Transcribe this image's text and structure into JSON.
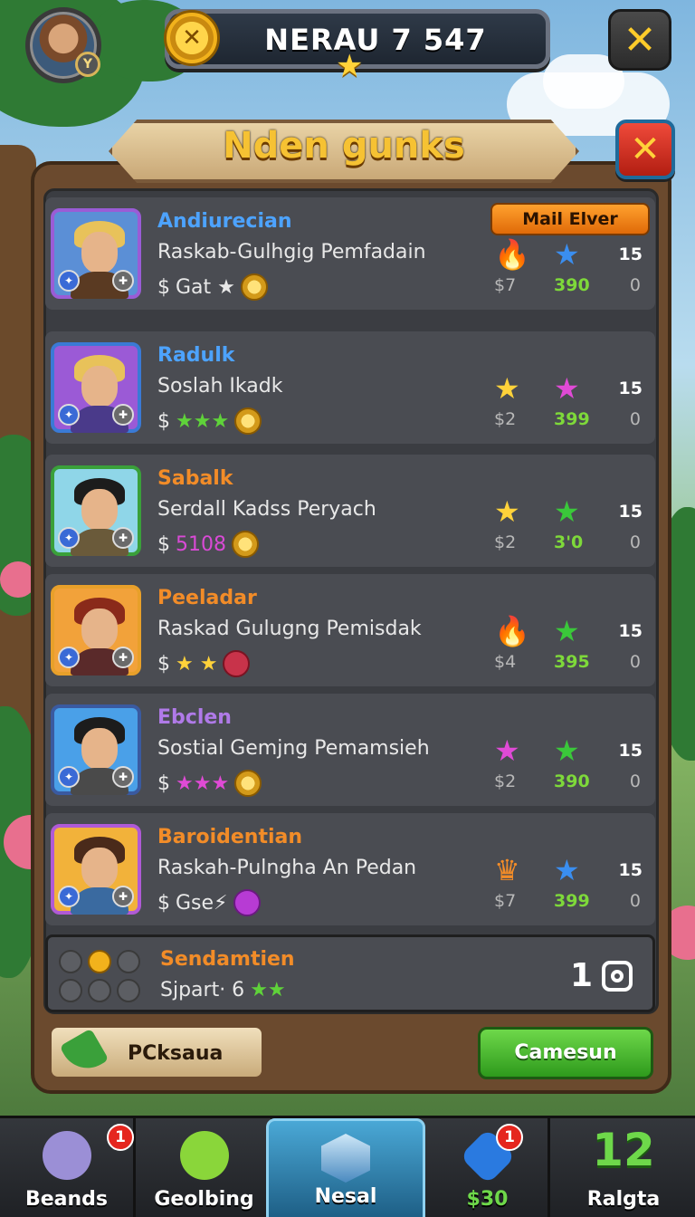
{
  "header": {
    "title": "NERAU 7 547",
    "coin_icon": "crossed-swords-coin-icon",
    "close_icon": "close-icon"
  },
  "panel": {
    "title": "Nden gunks",
    "close_icon": "close-icon"
  },
  "rows": [
    {
      "name": "Andiurecian",
      "name_color": "#4da3ff",
      "desc": "Raskab-Gulhgig Pemfadain",
      "line3_prefix": "$",
      "line3_text": "Gat ★",
      "portrait_border": "#9a5cd6",
      "portrait_bg": "#5b8fd6",
      "hair": "#e8c25a",
      "body": "#5a3a22",
      "icon1": "🔥",
      "icon1_color": "#e2442a",
      "icon2": "★",
      "icon2_color": "#3a8ef0",
      "stat_top": "15",
      "stat1": "$7",
      "stat2": "390",
      "stat_zero": "0",
      "action": "Mail Elver",
      "line3_item": "coin"
    },
    {
      "name": "Radulk",
      "name_color": "#4da3ff",
      "desc": "Soslah Ikadk",
      "line3_prefix": "$",
      "line3_text": "★★★",
      "line3_color": "#5fd23a",
      "portrait_border": "#3a7ad6",
      "portrait_bg": "#9b5ad6",
      "hair": "#e8c25a",
      "body": "#4a3a8a",
      "icon1": "★",
      "icon1_color": "#ffd23a",
      "icon2": "★",
      "icon2_color": "#e04ad6",
      "stat_top": "15",
      "stat1": "$2",
      "stat2": "399",
      "stat_zero": "0",
      "line3_item": "coin"
    },
    {
      "name": "Sabalk",
      "name_color": "#f28c28",
      "desc": "Serdall Kadss Peryach",
      "line3_prefix": "$",
      "line3_text": "5108",
      "line3_color": "#d94ad6",
      "portrait_border": "#3aa03a",
      "portrait_bg": "#8fd6e8",
      "hair": "#1c1c1c",
      "body": "#6a5a3a",
      "icon1": "★",
      "icon1_color": "#ffd23a",
      "icon2": "★",
      "icon2_color": "#3ac83a",
      "stat_top": "15",
      "stat1": "$2",
      "stat2": "3'0",
      "stat_zero": "0",
      "line3_item": "coin"
    },
    {
      "name": "Peeladar",
      "name_color": "#f28c28",
      "desc": "Raskad Gulugng Pemisdak",
      "line3_prefix": "$",
      "line3_text": "★ ★",
      "line3_color": "#ffd23a",
      "portrait_border": "#e8a02a",
      "portrait_bg": "#f2a23a",
      "hair": "#8a2a1a",
      "body": "#5a2a2a",
      "icon1": "🔥",
      "icon1_color": "#e2442a",
      "icon2": "★",
      "icon2_color": "#3ac83a",
      "stat_top": "15",
      "stat1": "$4",
      "stat2": "395",
      "stat_zero": "0",
      "line3_item": "gem"
    },
    {
      "name": "Ebclen",
      "name_color": "#b07ae8",
      "desc": "Sostial Gemjng Pemamsieh",
      "line3_prefix": "$",
      "line3_text": "★★★",
      "line3_color": "#e04ad6",
      "portrait_border": "#3a5aa0",
      "portrait_bg": "#4aa0e8",
      "hair": "#1c1c1c",
      "body": "#4a4a4a",
      "icon1": "★",
      "icon1_color": "#e04ad6",
      "icon2": "★",
      "icon2_color": "#3ac83a",
      "stat_top": "15",
      "stat1": "$2",
      "stat2": "390",
      "stat_zero": "0",
      "line3_item": "coin"
    },
    {
      "name": "Baroidentian",
      "name_color": "#f28c28",
      "desc": "Raskah-Pulngha An Pedan",
      "line3_prefix": "$",
      "line3_text": "Gse⚡",
      "portrait_border": "#b05ad6",
      "portrait_bg": "#f2b23a",
      "hair": "#4a2a1a",
      "body": "#3a6aa0",
      "icon1": "♛",
      "icon1_color": "#f28c28",
      "icon2": "★",
      "icon2_color": "#3a8ef0",
      "stat_top": "15",
      "stat1": "$7",
      "stat2": "399",
      "stat_zero": "0",
      "line3_item": "gem-purple"
    }
  ],
  "summary": {
    "name": "Sendamtien",
    "line": "Sjpart· 6",
    "stars": "★★",
    "count": "1",
    "camera_icon": "camera-icon"
  },
  "buttons": {
    "left_label": "PCksaua",
    "right_label": "Camesun"
  },
  "nav": [
    {
      "label": "Beands",
      "notif": "1",
      "icon": "character-icon"
    },
    {
      "label": "Geolbing",
      "notif": "",
      "icon": "pet-icon"
    },
    {
      "label": "Nesal",
      "notif": "",
      "icon": "shield-icon",
      "active": true
    },
    {
      "label": "$30",
      "notif": "1",
      "icon": "arrow-box-icon"
    },
    {
      "label": "Ralgta",
      "big": "12",
      "icon": "level-icon"
    }
  ]
}
